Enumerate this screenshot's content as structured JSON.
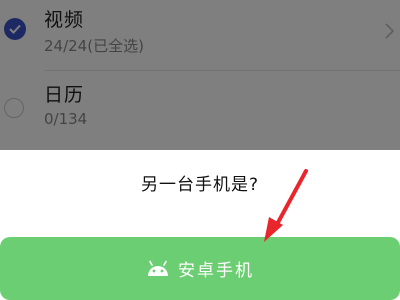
{
  "list": {
    "items": [
      {
        "title": "视频",
        "subtitle": "24/24(已全选)",
        "checked": true
      },
      {
        "title": "日历",
        "subtitle": "0/134",
        "checked": false
      }
    ]
  },
  "dialog": {
    "question": "另一台手机是?",
    "android_button_label": "安卓手机"
  },
  "colors": {
    "accent_blue": "#3b52c7",
    "button_green": "#6bce72",
    "annotation_red": "#e8262b"
  },
  "icons": {
    "check": "check-icon",
    "chevron": "chevron-right-icon",
    "android": "android-icon",
    "arrow": "red-arrow-annotation"
  }
}
